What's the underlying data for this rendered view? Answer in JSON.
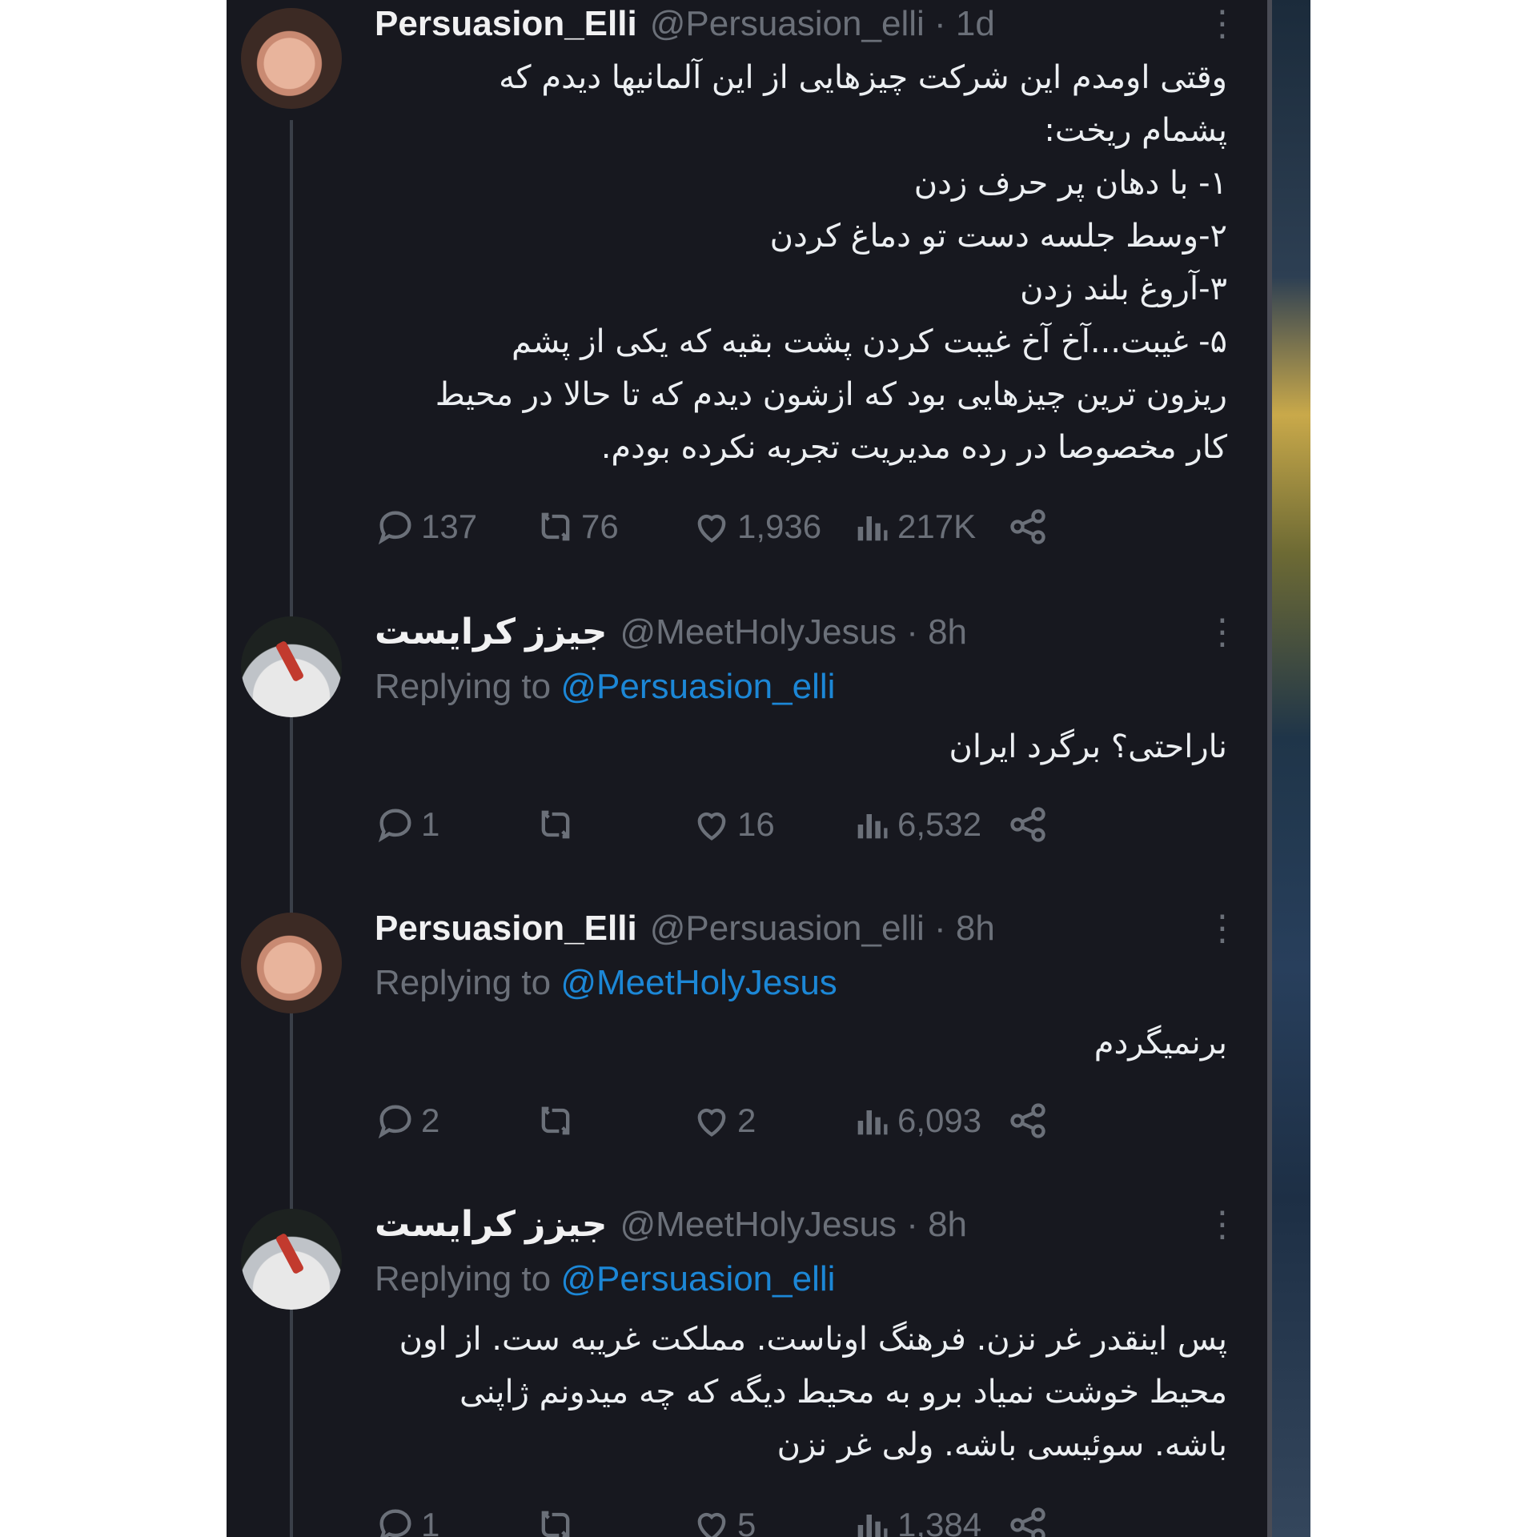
{
  "colors": {
    "panel_bg": "#17181f",
    "name": "#f1f1f2",
    "muted": "#6b7079",
    "link": "#1c87d6",
    "text": "#eceff2"
  },
  "tweets": [
    {
      "name": "Persuasion_Elli",
      "meta": "@Persuasion_elli · 1d",
      "more": "⋮",
      "replying_prefix": "",
      "replying_handle": "",
      "lines": [
        "وقتی اومدم این شرکت چیزهایی از این آلمانیها دیدم که",
        "پشمام ریخت:",
        "۱- با دهان پر حرف زدن",
        "۲-وسط جلسه دست تو دماغ کردن",
        "۳-آروغ بلند زدن",
        "۵- غیبت...آخ آخ غیبت کردن پشت بقیه که یکی از پشم",
        "ریزون ترین چیزهایی بود که ازشون دیدم که تا حالا در محیط",
        "کار مخصوصا  در رده مدیریت تجربه نکرده بودم."
      ],
      "stats": {
        "replies": "137",
        "retweets": "76",
        "likes": "1,936",
        "views": "217K"
      }
    },
    {
      "name": "جیزز کرایست",
      "meta": "@MeetHolyJesus · 8h",
      "more": "⋮",
      "replying_prefix": "Replying to ",
      "replying_handle": "@Persuasion_elli",
      "lines": [
        "ناراحتی؟ برگرد ایران"
      ],
      "stats": {
        "replies": "1",
        "retweets": "",
        "likes": "16",
        "views": "6,532"
      }
    },
    {
      "name": "Persuasion_Elli",
      "meta": "@Persuasion_elli · 8h",
      "more": "⋮",
      "replying_prefix": "Replying to ",
      "replying_handle": "@MeetHolyJesus",
      "lines": [
        "برنمیگردم"
      ],
      "stats": {
        "replies": "2",
        "retweets": "",
        "likes": "2",
        "views": "6,093"
      }
    },
    {
      "name": "جیزز کرایست",
      "meta": "@MeetHolyJesus · 8h",
      "more": "⋮",
      "replying_prefix": "Replying to ",
      "replying_handle": "@Persuasion_elli",
      "lines": [
        "پس اینقدر غر نزن. فرهنگ اوناست. مملکت غریبه ست. از اون",
        "محیط خوشت نمیاد برو به محیط دیگه که چه میدونم ژاپنی",
        "باشه. سوئیسی باشه. ولی غر نزن"
      ],
      "stats": {
        "replies": "1",
        "retweets": "",
        "likes": "5",
        "views": "1,384"
      }
    }
  ],
  "icons": {
    "reply": "reply-icon",
    "retweet": "retweet-icon",
    "like": "heart-icon",
    "views": "views-icon",
    "share": "share-icon",
    "more": "more-icon"
  }
}
